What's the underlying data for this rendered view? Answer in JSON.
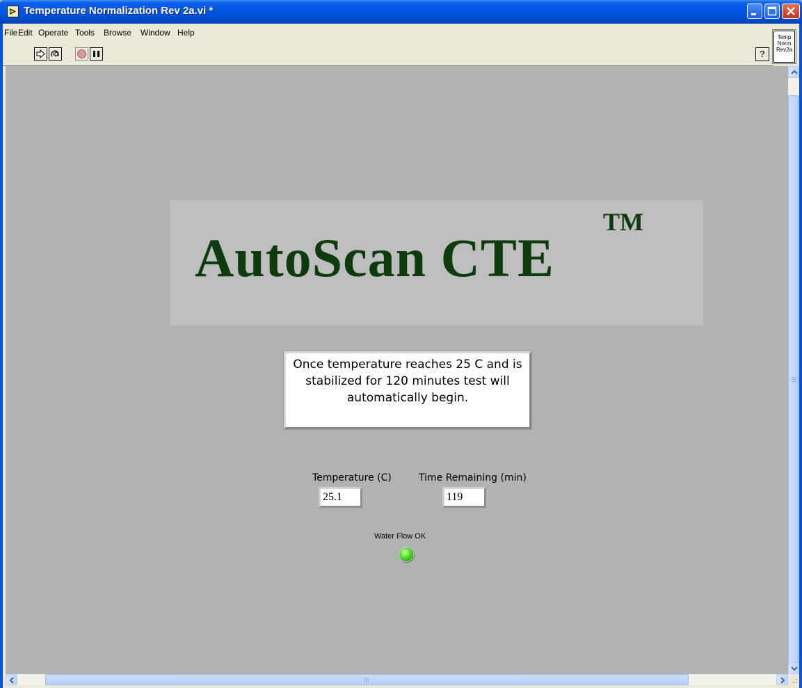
{
  "window": {
    "title": "Temperature Normalization Rev 2a.vi *"
  },
  "menu": {
    "items": [
      "File",
      "Edit",
      "Operate",
      "Tools",
      "Browse",
      "Window",
      "Help"
    ]
  },
  "toolbar": {
    "run_icon": "run-arrow-icon",
    "run_continuous_icon": "run-continuously-icon",
    "abort_icon": "abort-stop-icon",
    "pause_icon": "pause-icon",
    "help_label": "?"
  },
  "vi_icon": {
    "line1": "Temp",
    "line2": "Norm",
    "line3": "Rev2a"
  },
  "banner": {
    "title": "AutoScan CTE",
    "trademark": "TM",
    "text_color": "#0d3b0d"
  },
  "message": {
    "text": "Once temperature reaches 25 C and is stabilized for 120 minutes test will automatically begin."
  },
  "indicators": {
    "temperature_label": "Temperature (C)",
    "temperature_value": "25.1",
    "time_label": "Time Remaining (min)",
    "time_value": "119",
    "water_flow_label": "Water Flow OK",
    "water_flow_led_color": "#3fcf1f"
  }
}
